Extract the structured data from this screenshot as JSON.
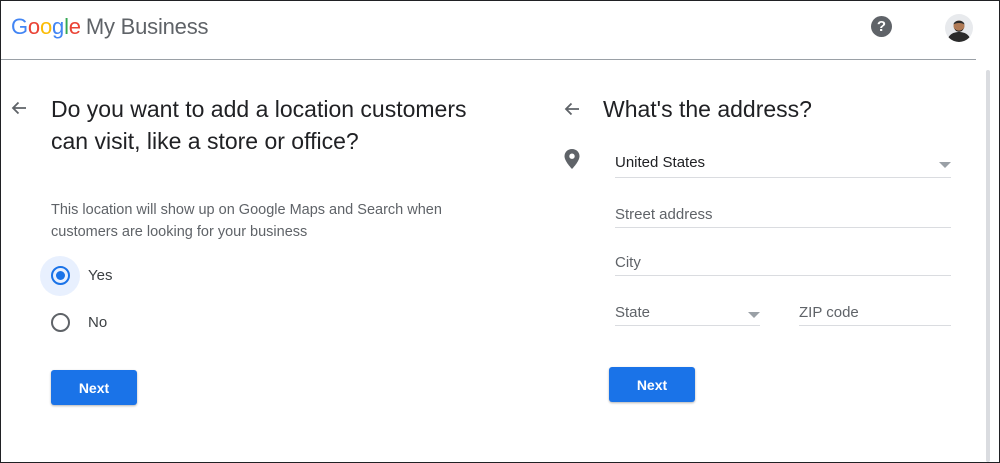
{
  "header": {
    "logo_letters": [
      "G",
      "o",
      "o",
      "g",
      "l",
      "e"
    ],
    "product": "My Business",
    "help_glyph": "?",
    "icons": {
      "help": "help-icon",
      "avatar": "avatar-icon"
    }
  },
  "left": {
    "title": "Do you want to add a location customers can visit, like a store or office?",
    "subtitle": "This location will show up on Google Maps and Search when customers are looking for your business",
    "options": [
      {
        "label": "Yes",
        "selected": true
      },
      {
        "label": "No",
        "selected": false
      }
    ],
    "next_label": "Next"
  },
  "right": {
    "title": "What's the address?",
    "country": {
      "value": "United States",
      "icon": "chevron-down-icon"
    },
    "street": {
      "placeholder": "Street address"
    },
    "city": {
      "placeholder": "City"
    },
    "state": {
      "placeholder": "State",
      "icon": "chevron-down-icon"
    },
    "zip": {
      "placeholder": "ZIP code"
    },
    "next_label": "Next"
  },
  "colors": {
    "accent": "#1a73e8",
    "text_primary": "#202124",
    "text_secondary": "#5f6368",
    "google_blue": "#4285f4",
    "google_red": "#ea4335",
    "google_yellow": "#fbbc05",
    "google_green": "#34a853"
  }
}
